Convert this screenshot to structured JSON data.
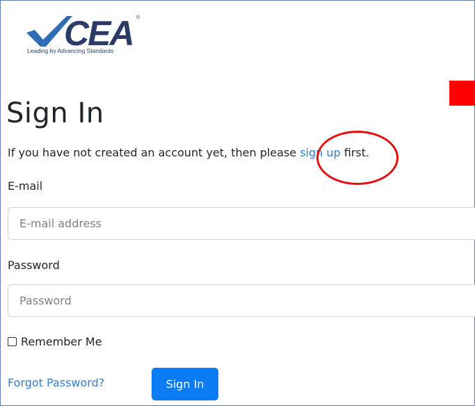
{
  "logo": {
    "brand": "CEA",
    "tagline": "Leading by Advancing Standards",
    "registered_mark": "®"
  },
  "title": "Sign In",
  "intro": {
    "prefix": "If you have not created an account yet, then please ",
    "link": "sign up",
    "suffix": " first."
  },
  "email": {
    "label": "E-mail",
    "placeholder": "E-mail address",
    "value": ""
  },
  "password": {
    "label": "Password",
    "placeholder": "Password",
    "value": ""
  },
  "remember": {
    "label": "Remember Me",
    "checked": false
  },
  "forgot_link": "Forgot Password?",
  "submit_label": "Sign In",
  "colors": {
    "link": "#2f7fd6",
    "button": "#0d7bf2",
    "annotation_circle": "#e01010",
    "annotation_square": "#ff0000",
    "logo_navy": "#2b3a67",
    "logo_blue": "#2f6db5"
  }
}
